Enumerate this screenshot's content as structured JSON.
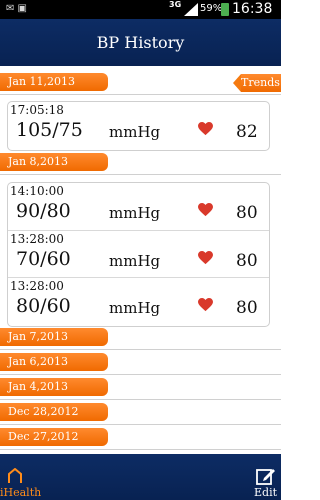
{
  "status_bar": {
    "network": "3G",
    "battery": "59%",
    "time": "16:38"
  },
  "header": {
    "title": "BP History"
  },
  "trends_label": "Trends",
  "unit": "mmHg",
  "groups": [
    {
      "date": "Jan 11,2013",
      "readings": [
        {
          "time": "17:05:18",
          "value": "105/75",
          "pulse": "82"
        }
      ]
    },
    {
      "date": "Jan 8,2013",
      "readings": [
        {
          "time": "14:10:00",
          "value": "90/80",
          "pulse": "80"
        },
        {
          "time": "13:28:00",
          "value": "70/60",
          "pulse": "80"
        },
        {
          "time": "13:28:00",
          "value": "80/60",
          "pulse": "80"
        }
      ]
    },
    {
      "date": "Jan 7,2013",
      "readings": []
    },
    {
      "date": "Jan 6,2013",
      "readings": []
    },
    {
      "date": "Jan 4,2013",
      "readings": []
    },
    {
      "date": "Dec 28,2012",
      "readings": []
    },
    {
      "date": "Dec 27,2012",
      "readings": []
    }
  ],
  "bottom_bar": {
    "home_label": "iHealth",
    "edit_label": "Edit"
  },
  "colors": {
    "accent": "#f57a10",
    "header": "#0b2758",
    "heart": "#d9392b"
  }
}
